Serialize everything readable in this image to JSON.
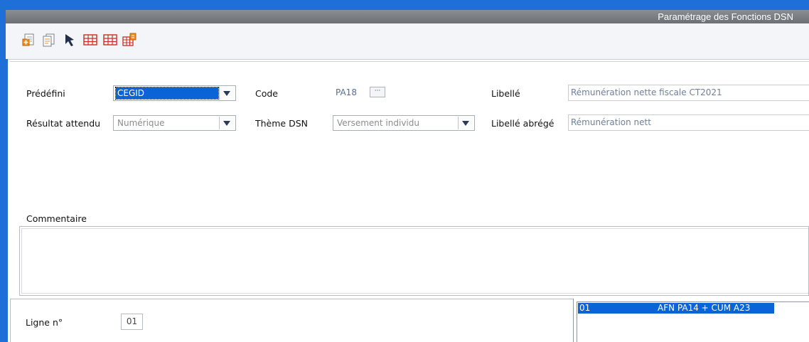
{
  "window": {
    "title": "Paramétrage des Fonctions DSN"
  },
  "toolbar": {
    "icons": [
      "new-record-icon",
      "duplicate-icon",
      "pointer-select-icon",
      "grid-icon",
      "grid-alt-icon",
      "grid-export-icon"
    ]
  },
  "form": {
    "predefini": {
      "label": "Prédéfini",
      "value": "CEGID"
    },
    "code": {
      "label": "Code",
      "value": "PA18",
      "button": "···"
    },
    "libelle": {
      "label": "Libellé",
      "value": "Rémunération nette fiscale CT2021"
    },
    "resultat": {
      "label": "Résultat attendu",
      "value": "Numérique"
    },
    "theme": {
      "label": "Thème DSN",
      "value": "Versement individu"
    },
    "libelle_abrege": {
      "label": "Libellé abrégé",
      "value": "Rémunération nett"
    },
    "commentaire": {
      "label": "Commentaire",
      "value": ""
    }
  },
  "lines": {
    "label": "Ligne n°",
    "value": "01",
    "list": [
      {
        "num": "01",
        "formula": "AFN PA14 + CUM A23"
      }
    ]
  },
  "colors": {
    "accent": "#1f6fd8",
    "selection": "#0a64d8",
    "titlebar": "#7a7e83"
  }
}
